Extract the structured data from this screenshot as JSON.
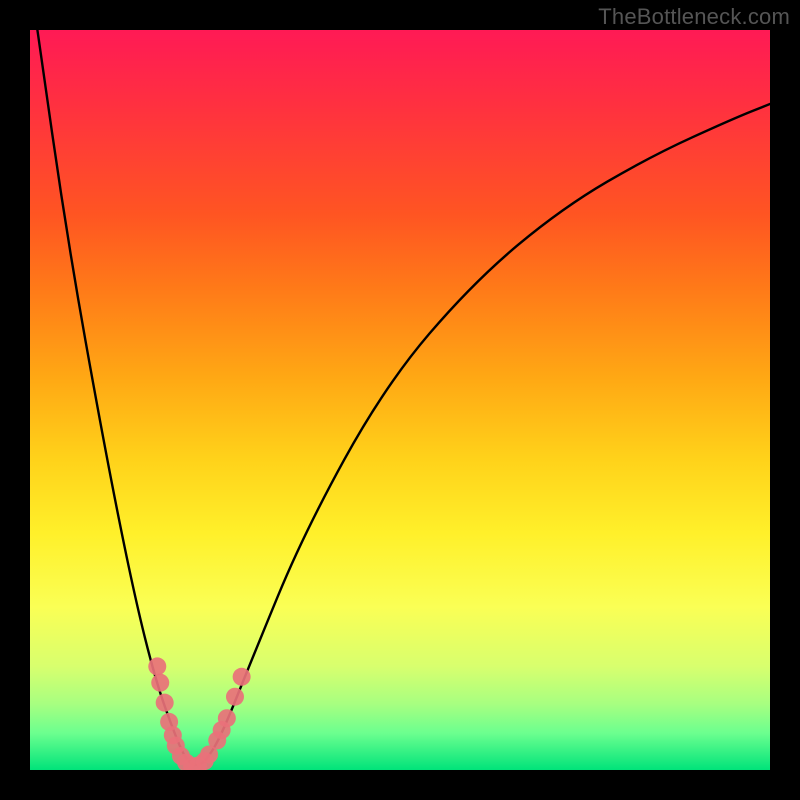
{
  "watermark": "TheBottleneck.com",
  "chart_data": {
    "type": "line",
    "title": "",
    "xlabel": "",
    "ylabel": "",
    "xlim": [
      0,
      100
    ],
    "ylim": [
      0,
      100
    ],
    "grid": false,
    "legend": false,
    "series": [
      {
        "name": "bottleneck-curve",
        "x": [
          1,
          5,
          10,
          14,
          17,
          19.5,
          21,
          22.5,
          24,
          26,
          30,
          37,
          48,
          60,
          72,
          84,
          95,
          100
        ],
        "y": [
          100,
          72,
          44,
          24,
          12,
          5,
          1.5,
          0.4,
          1.5,
          5,
          15,
          32,
          52,
          66,
          76,
          83,
          88,
          90
        ]
      }
    ],
    "markers": {
      "name": "highlight-points",
      "x": [
        17.2,
        17.6,
        18.2,
        18.8,
        19.3,
        19.7,
        20.4,
        21.1,
        21.9,
        22.7,
        23.6,
        24.2,
        25.3,
        25.9,
        26.6,
        27.7,
        28.6
      ],
      "y": [
        14.0,
        11.8,
        9.1,
        6.5,
        4.7,
        3.3,
        1.9,
        1.0,
        0.5,
        0.6,
        1.2,
        2.1,
        4.0,
        5.4,
        7.0,
        9.9,
        12.6
      ]
    },
    "background_gradient": {
      "top": "#ff1a55",
      "bottom": "#00e37a"
    }
  }
}
